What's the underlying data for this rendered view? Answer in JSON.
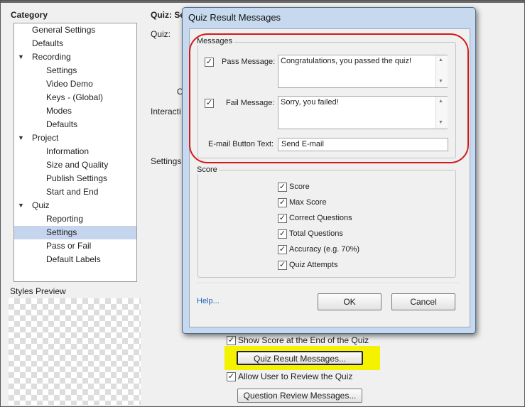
{
  "category": {
    "title": "Category",
    "items": [
      {
        "label": "General Settings",
        "level": 1,
        "expand": false,
        "selected": false
      },
      {
        "label": "Defaults",
        "level": 1,
        "expand": false,
        "selected": false
      },
      {
        "label": "Recording",
        "level": 1,
        "expand": true,
        "selected": false
      },
      {
        "label": "Settings",
        "level": 2,
        "expand": false,
        "selected": false
      },
      {
        "label": "Video Demo",
        "level": 2,
        "expand": false,
        "selected": false
      },
      {
        "label": "Keys - (Global)",
        "level": 2,
        "expand": false,
        "selected": false
      },
      {
        "label": "Modes",
        "level": 2,
        "expand": false,
        "selected": false
      },
      {
        "label": "Defaults",
        "level": 2,
        "expand": false,
        "selected": false
      },
      {
        "label": "Project",
        "level": 1,
        "expand": true,
        "selected": false
      },
      {
        "label": "Information",
        "level": 2,
        "expand": false,
        "selected": false
      },
      {
        "label": "Size and Quality",
        "level": 2,
        "expand": false,
        "selected": false
      },
      {
        "label": "Publish Settings",
        "level": 2,
        "expand": false,
        "selected": false
      },
      {
        "label": "Start and End",
        "level": 2,
        "expand": false,
        "selected": false
      },
      {
        "label": "Quiz",
        "level": 1,
        "expand": true,
        "selected": false
      },
      {
        "label": "Reporting",
        "level": 2,
        "expand": false,
        "selected": false
      },
      {
        "label": "Settings",
        "level": 2,
        "expand": false,
        "selected": true
      },
      {
        "label": "Pass or Fail",
        "level": 2,
        "expand": false,
        "selected": false
      },
      {
        "label": "Default Labels",
        "level": 2,
        "expand": false,
        "selected": false
      }
    ],
    "styles_preview": "Styles Preview"
  },
  "background": {
    "header": "Quiz: Se",
    "quiz_label": "Quiz:",
    "o_label": "O",
    "interaction_label": "Interacti",
    "settings_label": "Settings:",
    "show_score_label": "Show Score at the End of the Quiz",
    "show_score_checked": true,
    "quiz_result_button": "Quiz Result Messages...",
    "allow_review_label": "Allow User to Review the Quiz",
    "allow_review_checked": true,
    "question_review_button": "Question Review Messages..."
  },
  "dialog": {
    "title": "Quiz Result Messages",
    "messages_group": "Messages",
    "pass_label": "Pass Message:",
    "pass_checked": true,
    "pass_value": "Congratulations, you passed the quiz!",
    "fail_label": "Fail Message:",
    "fail_checked": true,
    "fail_value": "Sorry, you failed!",
    "email_label": "E-mail Button Text:",
    "email_value": "Send E-mail",
    "score_group": "Score",
    "score_items": [
      {
        "label": "Score",
        "checked": true
      },
      {
        "label": "Max Score",
        "checked": true
      },
      {
        "label": "Correct Questions",
        "checked": true
      },
      {
        "label": "Total Questions",
        "checked": true
      },
      {
        "label": "Accuracy (e.g. 70%)",
        "checked": true
      },
      {
        "label": "Quiz Attempts",
        "checked": true
      }
    ],
    "help": "Help...",
    "ok": "OK",
    "cancel": "Cancel"
  },
  "colors": {
    "highlight": "#f5f200",
    "annotation": "#d11a1a",
    "selection": "#c5d5ee",
    "link": "#1f5fb4"
  }
}
